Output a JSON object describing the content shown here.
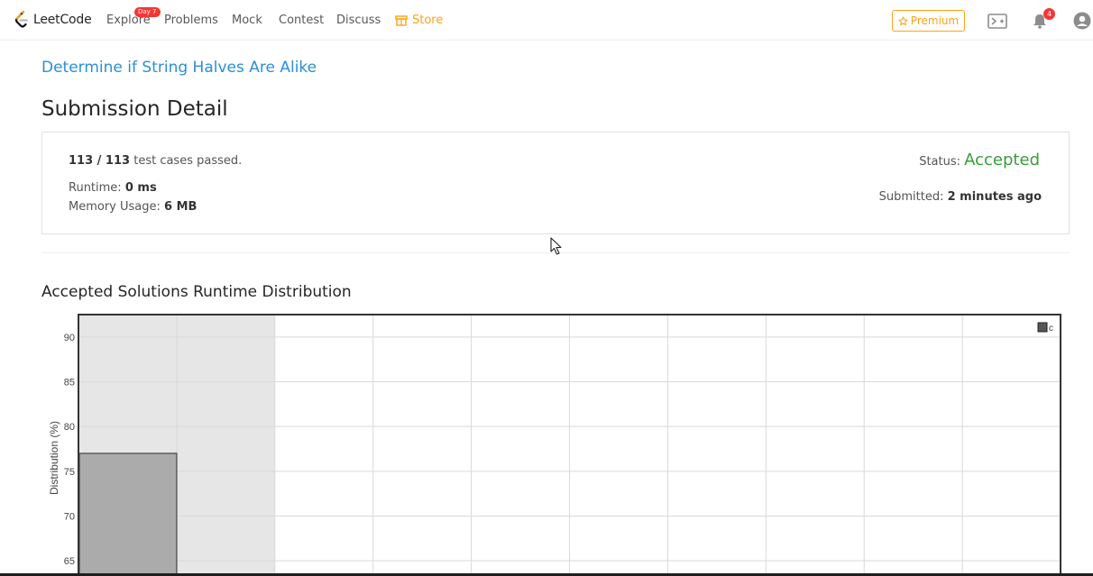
{
  "nav": {
    "logo_text": "LeetCode",
    "items": [
      "Explore",
      "Problems",
      "Mock",
      "Contest",
      "Discuss"
    ],
    "store_label": "Store",
    "explore_badge": "Day 7",
    "premium_label": "Premium",
    "notification_count": "4"
  },
  "problem": {
    "title": "Determine if String Halves Are Alike"
  },
  "page": {
    "title": "Submission Detail"
  },
  "detail": {
    "passed": "113 / 113",
    "passed_suffix": "test cases passed.",
    "runtime_label": "Runtime:",
    "runtime_value": "0 ms",
    "memory_label": "Memory Usage:",
    "memory_value": "6 MB",
    "status_label": "Status:",
    "status_value": "Accepted",
    "submitted_label": "Submitted:",
    "submitted_value": "2 minutes ago"
  },
  "section": {
    "runtime_dist_title": "Accepted Solutions Runtime Distribution"
  },
  "chart_data": {
    "type": "bar",
    "title": "",
    "xlabel": "",
    "ylabel": "Distribution (%)",
    "ylim": [
      62.3,
      92.5
    ],
    "yticks": [
      65,
      70,
      75,
      80,
      85,
      90
    ],
    "x_slots": 10,
    "highlight_slots": 2,
    "bars": [
      {
        "slot": 0,
        "value": 77.0
      }
    ],
    "legend": [
      "c"
    ],
    "legend_position": "top-right",
    "grid": true,
    "colors": {
      "bar": "#ababab",
      "highlight": "#e6e6e6",
      "frame": "#333333",
      "grid": "#d9d9d9"
    }
  },
  "colors": {
    "brand_orange": "#ffa116",
    "link_blue": "#2c8fd6",
    "accepted_green": "#3b9c3b"
  }
}
